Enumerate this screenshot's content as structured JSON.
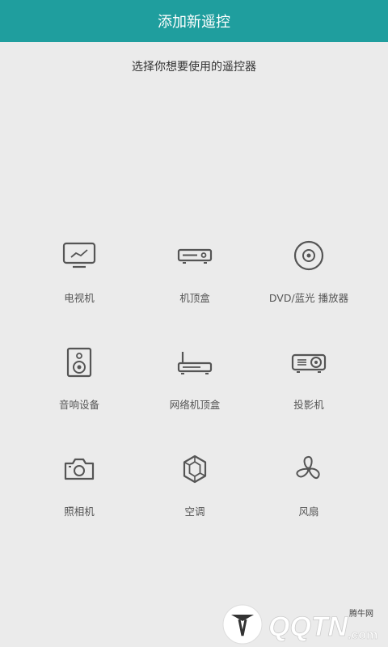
{
  "header": {
    "title": "添加新遥控"
  },
  "subtitle": "选择你想要使用的遥控器",
  "devices": [
    {
      "label": "电视机",
      "icon": "tv-icon"
    },
    {
      "label": "机顶盒",
      "icon": "set-top-box-icon"
    },
    {
      "label": "DVD/蓝光 播放器",
      "icon": "disc-icon"
    },
    {
      "label": "音响设备",
      "icon": "speaker-icon"
    },
    {
      "label": "网络机顶盒",
      "icon": "router-icon"
    },
    {
      "label": "投影机",
      "icon": "projector-icon"
    },
    {
      "label": "照相机",
      "icon": "camera-icon"
    },
    {
      "label": "空调",
      "icon": "ac-icon"
    },
    {
      "label": "风扇",
      "icon": "fan-icon"
    }
  ],
  "watermark": {
    "site": "QQTN.com",
    "caption": "腾牛网"
  },
  "colors": {
    "header": "#1f9e9e",
    "background": "#ebebeb",
    "icon": "#555555"
  }
}
